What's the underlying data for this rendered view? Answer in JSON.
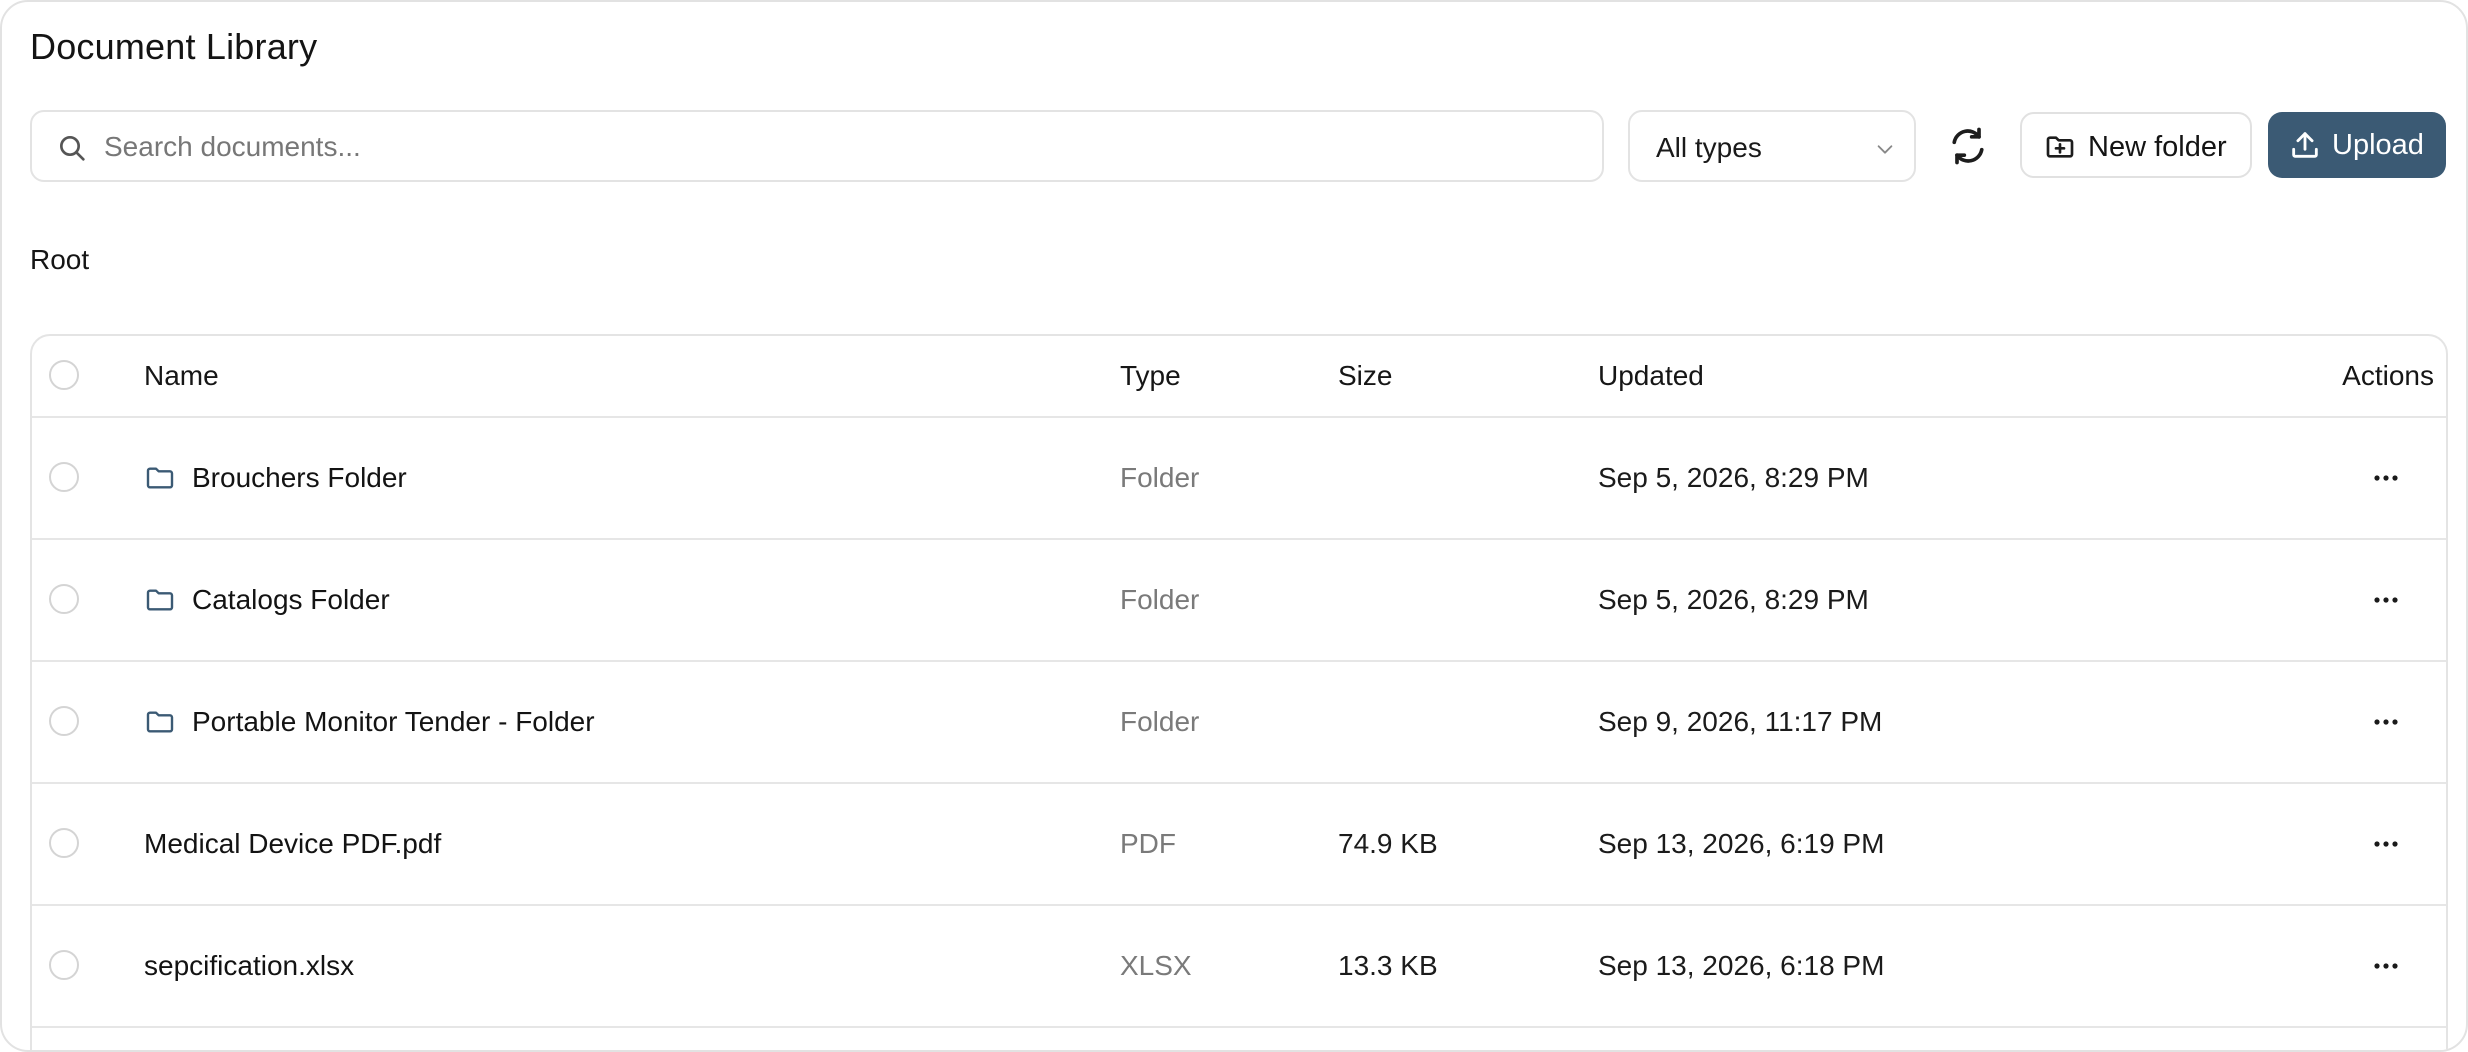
{
  "title": "Document Library",
  "search": {
    "placeholder": "Search documents...",
    "value": "",
    "icon": "search-icon"
  },
  "filter": {
    "selected": "All types",
    "icon": "chevron-down-icon"
  },
  "toolbar": {
    "refresh_icon": "refresh-icon",
    "new_folder_label": "New folder",
    "upload_label": "Upload"
  },
  "breadcrumb": "Root",
  "table": {
    "headers": {
      "name": "Name",
      "type": "Type",
      "size": "Size",
      "updated": "Updated",
      "actions": "Actions"
    },
    "rows": [
      {
        "name": "Brouchers Folder",
        "type": "Folder",
        "size": "",
        "updated": "Sep 5, 2026, 8:29 PM",
        "icon": "folder-icon"
      },
      {
        "name": "Catalogs Folder",
        "type": "Folder",
        "size": "",
        "updated": "Sep 5, 2026, 8:29 PM",
        "icon": "folder-icon"
      },
      {
        "name": "Portable Monitor Tender - Folder",
        "type": "Folder",
        "size": "",
        "updated": "Sep 9, 2026, 11:17 PM",
        "icon": "folder-icon"
      },
      {
        "name": "Medical Device PDF.pdf",
        "type": "PDF",
        "size": "74.9 KB",
        "updated": "Sep 13, 2026, 6:19 PM"
      },
      {
        "name": "sepcification.xlsx",
        "type": "XLSX",
        "size": "13.3 KB",
        "updated": "Sep 13, 2026, 6:18 PM"
      }
    ]
  },
  "colors": {
    "primary": "#3b5a74",
    "border": "#e3e3e3",
    "muted_text": "#7a7a7a"
  }
}
